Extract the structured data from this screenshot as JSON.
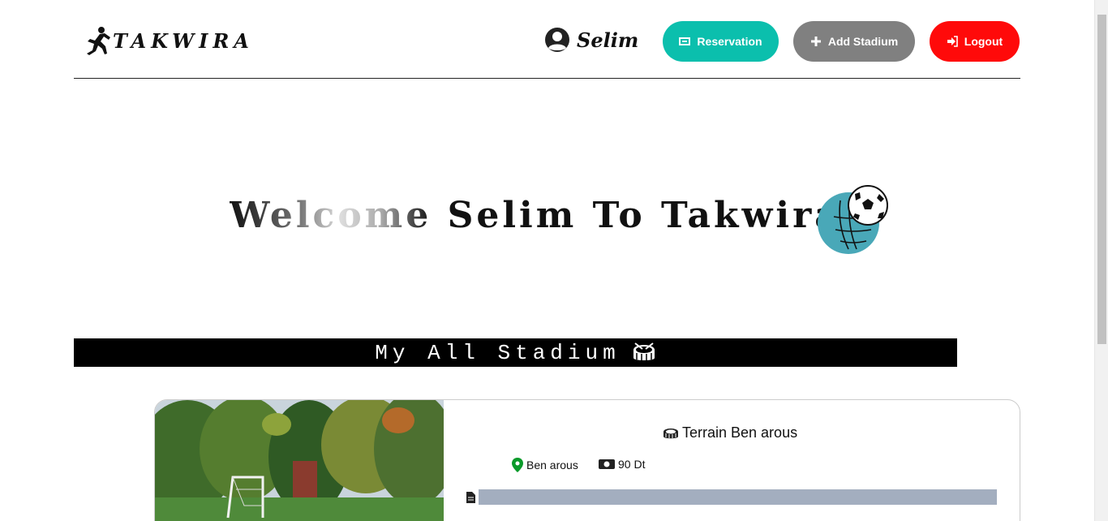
{
  "header": {
    "logo_text": "TAKWIRA",
    "user_name": "Selim",
    "buttons": {
      "reservation": "Reservation",
      "add_stadium": "Add Stadium",
      "logout": "Logout"
    },
    "icons": {
      "reservation": "ticket-icon",
      "add_stadium": "plus-icon",
      "logout": "sign-in-icon",
      "user": "user-circle-icon"
    },
    "colors": {
      "reservation": "#0bbfad",
      "add_stadium": "#808080",
      "logout": "#ff0a0a"
    }
  },
  "welcome": {
    "part1": "Welcome",
    "part2": "Selim To Takwira"
  },
  "section": {
    "title": "My All Stadium"
  },
  "stadiums": [
    {
      "name": "Terrain Ben arous",
      "location": "Ben arous",
      "price": "90 Dt"
    }
  ]
}
